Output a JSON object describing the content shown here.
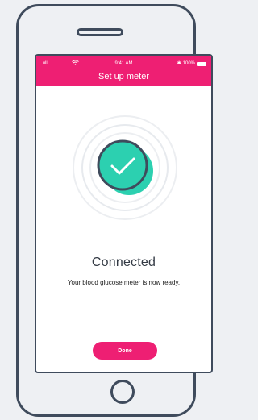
{
  "status_bar": {
    "signal": ".ull",
    "time": "9:41 AM",
    "battery": "100%"
  },
  "header": {
    "title": "Set up meter"
  },
  "main": {
    "status_title": "Connected",
    "status_message": "Your blood glucose meter is now ready.",
    "done_label": "Done"
  },
  "colors": {
    "accent": "#ee1f73",
    "success": "#2cd0b0",
    "frame": "#3f4b5c"
  }
}
